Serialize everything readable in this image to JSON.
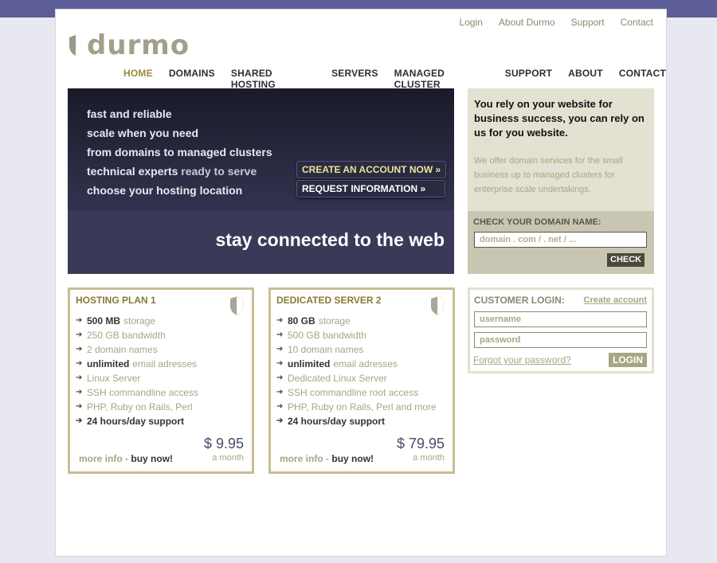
{
  "header": {
    "logo_text": "durmo",
    "toplinks": [
      "Login",
      "About Durmo",
      "Support",
      "Contact"
    ]
  },
  "nav": {
    "items": [
      "HOME",
      "DOMAINS",
      "SHARED HOSTING",
      "SERVERS",
      "MANAGED CLUSTER",
      "SUPPORT",
      "ABOUT",
      "CONTACT"
    ],
    "active": "HOME"
  },
  "hero": {
    "lines": [
      {
        "strong": "fast and reliable",
        "dim": ""
      },
      {
        "strong": "scale when you need",
        "dim": ""
      },
      {
        "strong": "from domains to managed clusters",
        "dim": ""
      },
      {
        "strong": "technical experts",
        "dim": " ready to serve"
      },
      {
        "strong": "choose your hosting location",
        "dim": ""
      }
    ],
    "create_button": "CREATE AN ACCOUNT NOW »",
    "request_button": "REQUEST INFORMATION »",
    "tagline": "stay connected to the web"
  },
  "promo": {
    "title": "You rely on your website for business success,  you can rely on us for you website.",
    "text": "We offer domain services for the small business up to managed clusters for enterprise scale undertakings.",
    "domain_label": "CHECK YOUR DOMAIN NAME:",
    "domain_placeholder": "domain . com / . net / ...",
    "check_button": "CHECK"
  },
  "plans": [
    {
      "title": "HOSTING PLAN 1",
      "features": [
        {
          "bold": "500 MB",
          "text": "storage",
          "strong": false
        },
        {
          "bold": "",
          "text": "250 GB bandwidth",
          "strong": false
        },
        {
          "bold": "",
          "text": "2 domain names",
          "strong": false
        },
        {
          "bold": "unlimited",
          "text": "email adresses",
          "strong": false
        },
        {
          "bold": "",
          "text": "Linux Server",
          "strong": false
        },
        {
          "bold": "",
          "text": "SSH commandline access",
          "strong": false
        },
        {
          "bold": "",
          "text": "PHP,  Ruby on Rails, Perl",
          "strong": false
        },
        {
          "bold": "",
          "text": "24 hours/day support",
          "strong": true
        }
      ],
      "price": "$ 9.95",
      "period": "a month",
      "more_info": "more info",
      "separator": "-",
      "buy_now": "buy now!"
    },
    {
      "title": "DEDICATED SERVER 2",
      "features": [
        {
          "bold": "80 GB",
          "text": "storage",
          "strong": false
        },
        {
          "bold": "",
          "text": "500 GB bandwidth",
          "strong": false
        },
        {
          "bold": "",
          "text": "10 domain names",
          "strong": false
        },
        {
          "bold": "unlimited",
          "text": "email adresses",
          "strong": false
        },
        {
          "bold": "",
          "text": "Dedicated Linux Server",
          "strong": false
        },
        {
          "bold": "",
          "text": "SSH commandline root access",
          "strong": false
        },
        {
          "bold": "",
          "text": "PHP,  Ruby on Rails, Perl and more",
          "strong": false
        },
        {
          "bold": "",
          "text": "24 hours/day support",
          "strong": true
        }
      ],
      "price": "$ 79.95",
      "period": "a month",
      "more_info": "more info",
      "separator": "-",
      "buy_now": "buy now!"
    }
  ],
  "login": {
    "title": "CUSTOMER LOGIN:",
    "create_link": "Create account",
    "username_placeholder": "username",
    "password_placeholder": "password",
    "forgot": "Forgot your password?",
    "button": "LOGIN"
  },
  "colors": {
    "top_band": "#5d5d99",
    "accent_gold": "#9b8a3a",
    "hero_dark": "#2b2c44",
    "card_border": "#c8bf95",
    "muted_text": "#a8a583"
  }
}
